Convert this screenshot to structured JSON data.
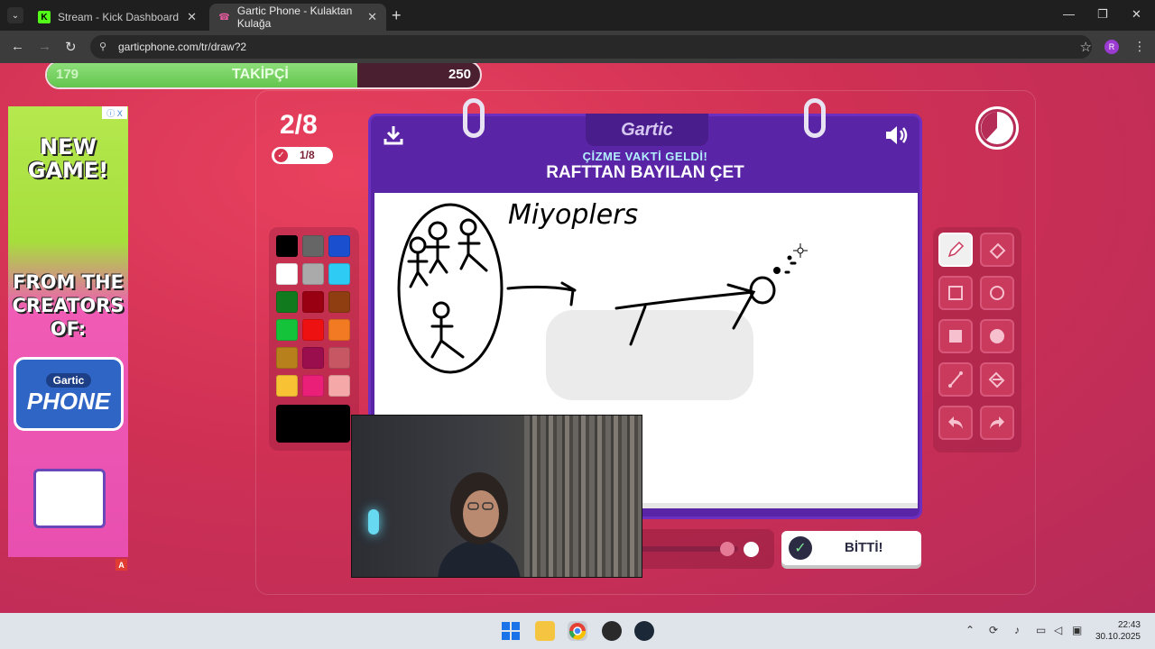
{
  "browser": {
    "tabs": [
      {
        "title": "Stream - Kick Dashboard",
        "icon": "kick-icon",
        "active": false
      },
      {
        "title": "Gartic Phone - Kulaktan Kulağa",
        "icon": "phone-icon",
        "active": true
      }
    ],
    "url": "garticphone.com/tr/draw?2",
    "profile_initial": "R"
  },
  "follower_goal": {
    "current": "179",
    "label": "TAKİPÇİ",
    "goal": "250",
    "progress": 0.716
  },
  "ad": {
    "headline": "NEW GAME!",
    "line2": "FROM THE CREATORS OF:",
    "logo_top": "Gartic",
    "logo_main": "PHONE",
    "badge": "A",
    "info": "ⓘ X"
  },
  "round": {
    "label": "2/8",
    "done": "1/8"
  },
  "board": {
    "brand": "Gartic",
    "subtitle": "ÇİZME VAKTİ GELDİ!",
    "prompt": "RAFTTAN BAYILAN ÇET",
    "canvas_text": "Miyoplers"
  },
  "palette": {
    "colors": [
      "#000000",
      "#666666",
      "#1a4fd0",
      "#ffffff",
      "#aaaaaa",
      "#2ecbf5",
      "#117a1e",
      "#990011",
      "#8e3e10",
      "#15c33b",
      "#ee1111",
      "#f27a22",
      "#b8801c",
      "#9a0e4e",
      "#c65763",
      "#f7c335",
      "#ea1f78",
      "#f5a8a8"
    ],
    "current": "#000000"
  },
  "tools": [
    "pencil-icon",
    "eraser-icon",
    "rect-outline-icon",
    "circle-outline-icon",
    "rect-fill-icon",
    "circle-fill-icon",
    "line-icon",
    "fill-bucket-icon",
    "undo-icon",
    "redo-icon"
  ],
  "done_button": {
    "label": "BİTTİ!"
  },
  "taskbar": {
    "time": "22:43",
    "date": "30.10.2025"
  }
}
